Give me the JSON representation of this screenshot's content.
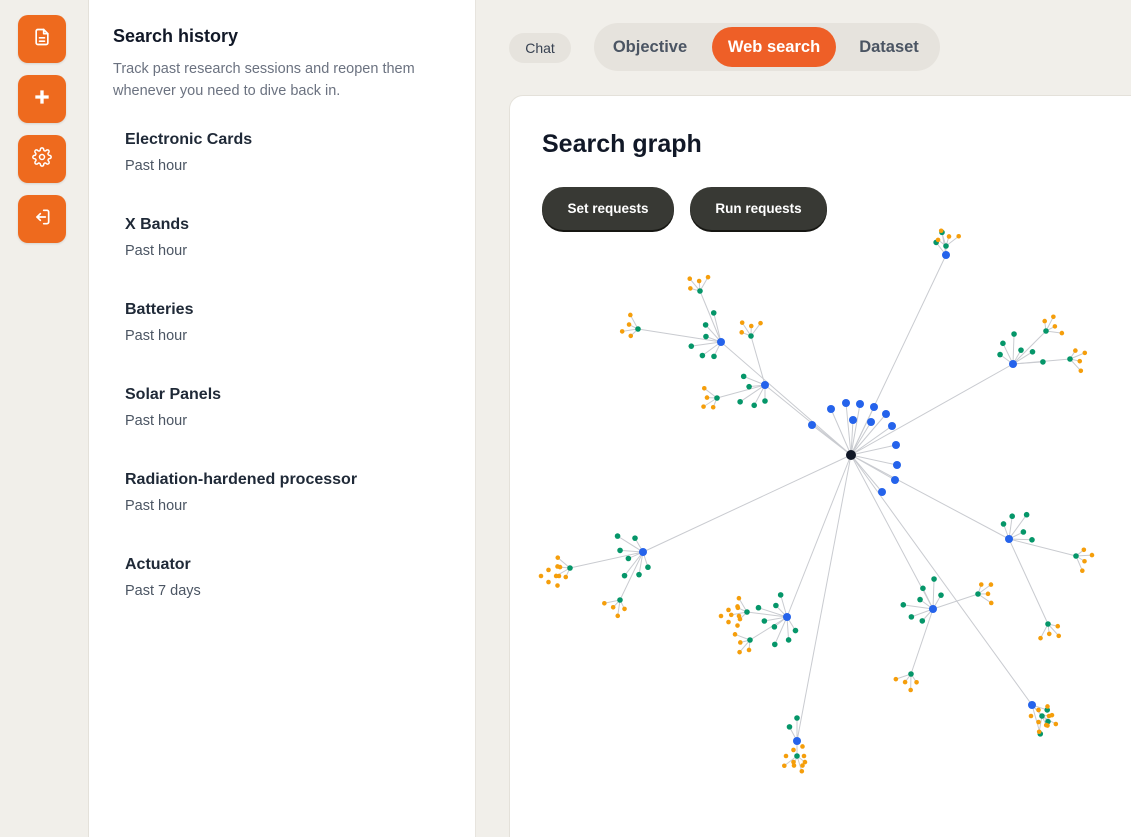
{
  "rail": {
    "icons": [
      "document-icon",
      "plus-icon",
      "gear-icon",
      "logout-icon"
    ]
  },
  "history": {
    "title": "Search history",
    "subtitle": "Track past research sessions and reopen them whenever you need to dive back in.",
    "items": [
      {
        "name": "Electronic Cards",
        "time": "Past hour"
      },
      {
        "name": "X Bands",
        "time": "Past hour"
      },
      {
        "name": "Batteries",
        "time": "Past hour"
      },
      {
        "name": "Solar Panels",
        "time": "Past hour"
      },
      {
        "name": "Radiation-hardened processor",
        "time": "Past hour"
      },
      {
        "name": "Actuator",
        "time": "Past 7 days"
      }
    ]
  },
  "header": {
    "chat_label": "Chat",
    "tabs": [
      "Objective",
      "Web search",
      "Dataset"
    ],
    "active_tab": "Web search"
  },
  "main": {
    "title": "Search graph",
    "set_requests_label": "Set requests",
    "run_requests_label": "Run requests"
  },
  "colors": {
    "accent": "#ee6a1e",
    "root_node": "#111827",
    "query_node": "#2563eb",
    "result_node": "#059669",
    "leaf_node": "#f59e0b",
    "edge": "#c9cbd0"
  }
}
